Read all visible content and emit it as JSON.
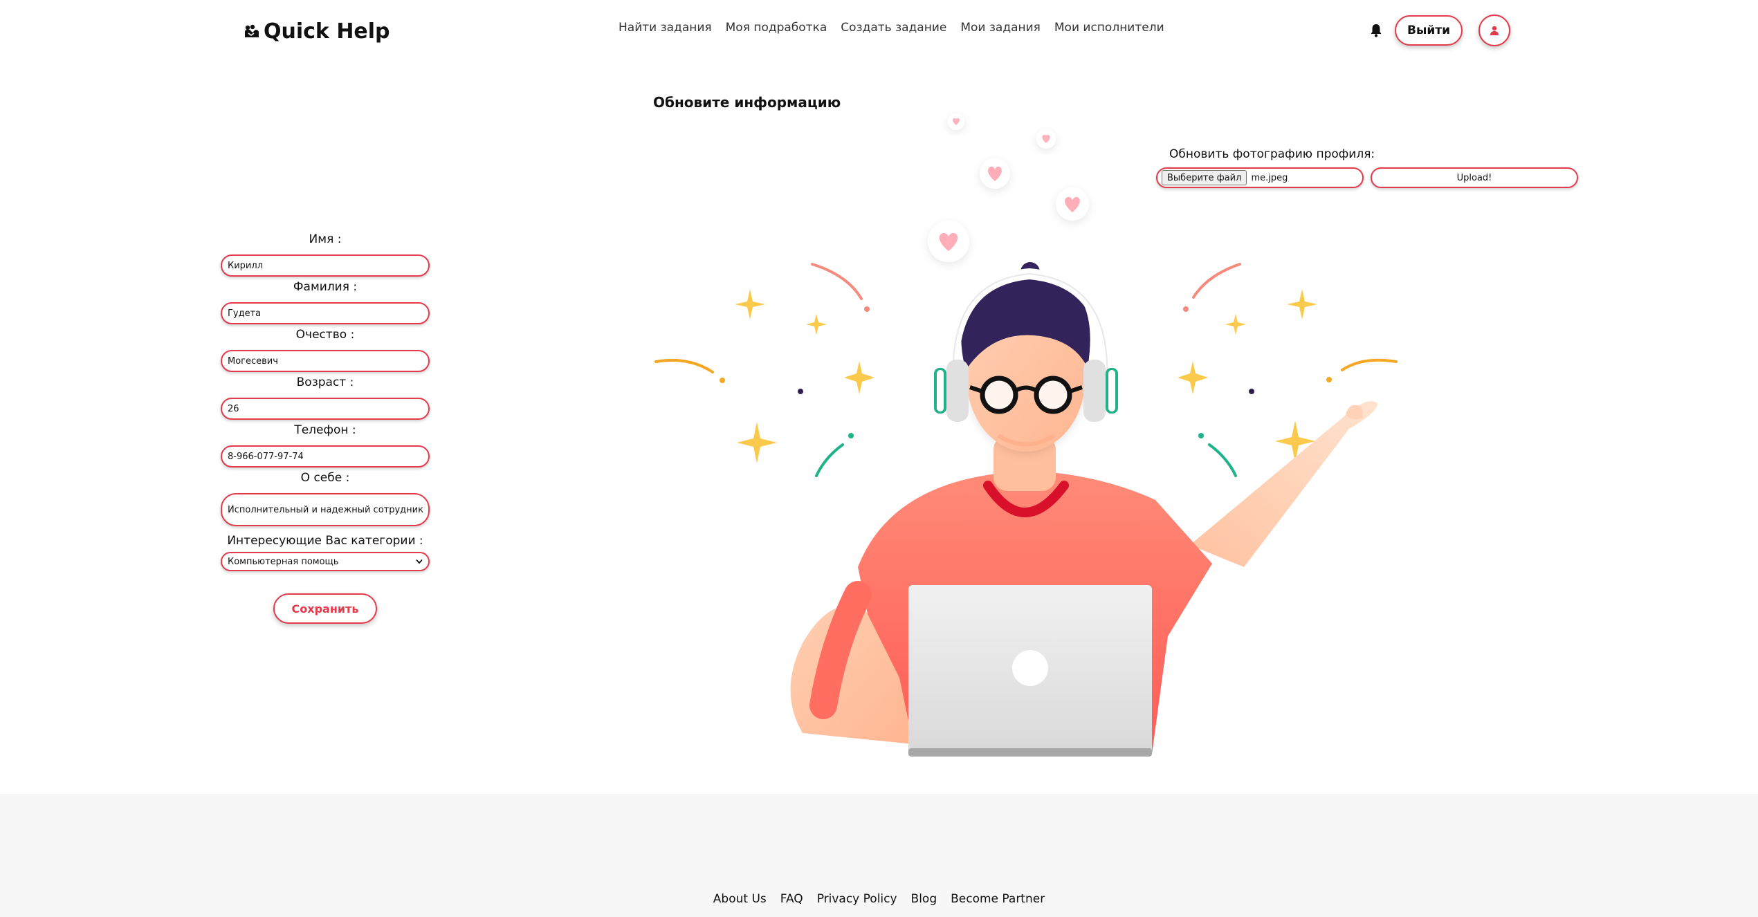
{
  "header": {
    "logo_text": "Quick Help",
    "nav": [
      {
        "label": "Найти задания"
      },
      {
        "label": "Моя подработка"
      },
      {
        "label": "Создать задание"
      },
      {
        "label": "Мои задания"
      },
      {
        "label": "Мои исполнители"
      }
    ],
    "logout_label": "Выйти",
    "icons": {
      "logo": "handshake-icon",
      "notifications": "bell-icon",
      "profile": "user-icon"
    }
  },
  "page_title": "Обновите информацию",
  "form": {
    "first_name": {
      "label": "Имя :",
      "value": "Кирилл"
    },
    "last_name": {
      "label": "Фамилия :",
      "value": "Гудета"
    },
    "patronymic": {
      "label": "Очество :",
      "value": "Могесевич"
    },
    "age": {
      "label": "Возраст :",
      "value": "26"
    },
    "phone": {
      "label": "Телефон :",
      "value": "8-966-077-97-74"
    },
    "about": {
      "label": "О себе :",
      "value": "Исполнительный и надежный сотрудник"
    },
    "category": {
      "label": "Интересующие Вас категории :",
      "value": "Компьютерная помощь"
    },
    "save_label": "Сохранить"
  },
  "photo": {
    "label": "Обновить фотографию профиля:",
    "choose_file_label": "Выберите файл",
    "file_name": "me.jpeg",
    "upload_label": "Upload!"
  },
  "footer": {
    "links": [
      {
        "label": "About Us"
      },
      {
        "label": "FAQ"
      },
      {
        "label": "Privacy Policy"
      },
      {
        "label": "Blog"
      },
      {
        "label": "Become Partner"
      }
    ]
  },
  "colors": {
    "accent": "#e53a4c",
    "footer_bg": "#f7f7f7",
    "text": "#111111"
  }
}
